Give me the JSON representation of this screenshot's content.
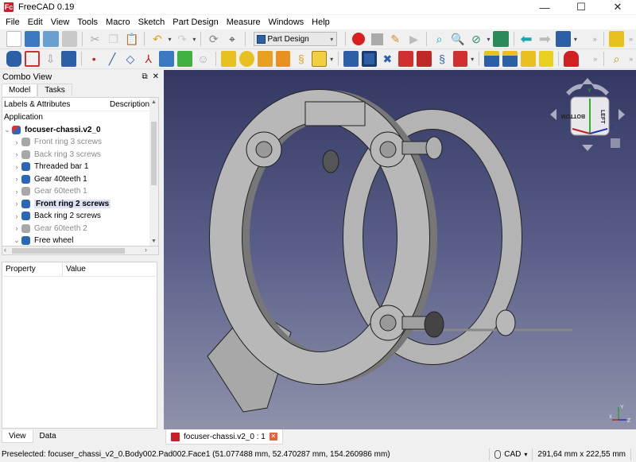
{
  "window": {
    "app_logo": "Fc",
    "title": "FreeCAD 0.19",
    "controls": {
      "minimize": "—",
      "maximize": "☐",
      "close": "✕"
    }
  },
  "menu": [
    "File",
    "Edit",
    "View",
    "Tools",
    "Macro",
    "Sketch",
    "Part Design",
    "Measure",
    "Windows",
    "Help"
  ],
  "toolbar1": {
    "left_icons": [
      "new-document",
      "open-document",
      "save",
      "save-as",
      "cut",
      "copy",
      "paste",
      "undo",
      "redo",
      "refresh",
      "whats-this"
    ],
    "workbench_selector": "Part Design",
    "macro_icons": [
      "macro-record",
      "macro-stop",
      "macro-edit",
      "macro-run"
    ],
    "view_icons": [
      "fit-all",
      "fit-selection",
      "draw-style",
      "bounding-box",
      "back",
      "forward",
      "standard-views"
    ],
    "more": "»"
  },
  "toolbar2": {
    "body_icons": [
      "create-body",
      "create-part",
      "import",
      "clone"
    ],
    "datum_icons": [
      "datum-point",
      "datum-line",
      "datum-plane",
      "local-coordinate-system",
      "shape-binder",
      "sub-shape-binder",
      "create-sketch"
    ],
    "additive_icons": [
      "pad",
      "revolution",
      "additive-loft",
      "additive-pipe",
      "additive-helix",
      "additive-primitive"
    ],
    "subtractive_icons": [
      "pocket",
      "hole",
      "groove",
      "subtractive-loft",
      "subtractive-pipe",
      "subtractive-helix",
      "subtractive-primitive"
    ],
    "dressup_icons": [
      "fillet",
      "chamfer",
      "draft",
      "thickness",
      "boolean"
    ],
    "more": "»"
  },
  "combo_view": {
    "title": "Combo View",
    "tabs": [
      "Model",
      "Tasks"
    ],
    "active_tab": "Model",
    "tree_headers": [
      "Labels & Attributes",
      "Description"
    ],
    "application_label": "Application",
    "document": "focuser-chassi.v2_0",
    "items": [
      {
        "label": "Front ring 3 screws",
        "visible": false,
        "expanded": false
      },
      {
        "label": "Back ring 3 screws",
        "visible": false,
        "expanded": false
      },
      {
        "label": "Threaded bar 1",
        "visible": true,
        "expanded": false
      },
      {
        "label": "Gear 40teeth 1",
        "visible": true,
        "expanded": false
      },
      {
        "label": "Gear 60teeth 1",
        "visible": false,
        "expanded": false
      },
      {
        "label": "Front ring 2 screws",
        "visible": true,
        "expanded": false,
        "preselected": true
      },
      {
        "label": "Back ring 2 screws",
        "visible": true,
        "expanded": false
      },
      {
        "label": "Gear 60teeth 2",
        "visible": false,
        "expanded": false
      },
      {
        "label": "Free wheel",
        "visible": true,
        "expanded": true
      }
    ],
    "property_headers": [
      "Property",
      "Value"
    ],
    "bottom_tabs": [
      "View",
      "Data"
    ],
    "active_bottom_tab": "View"
  },
  "viewport": {
    "model": "focuser chassis assembly",
    "navcube": {
      "front_face": "BOTTOM",
      "right_face": "LEFT",
      "axis_labels": [
        "X",
        "Y",
        "Z"
      ]
    },
    "axis_cross": [
      "X",
      "Y",
      "Z"
    ]
  },
  "document_tab": {
    "label": "focuser-chassi.v2_0 : 1",
    "close": "✕"
  },
  "status": {
    "message": "Preselected: focuser_chassi_v2_0.Body002.Pad002.Face1 (51.077488 mm, 52.470287 mm, 154.260986 mm)",
    "navigation_style": "CAD",
    "dimensions": "291,64 mm x 222,55 mm"
  },
  "colors": {
    "viewport_top": "#333862",
    "viewport_bottom": "#8f92aa",
    "model_grey": "#b4b4b4",
    "preselect_highlight": "#dde3f7"
  }
}
